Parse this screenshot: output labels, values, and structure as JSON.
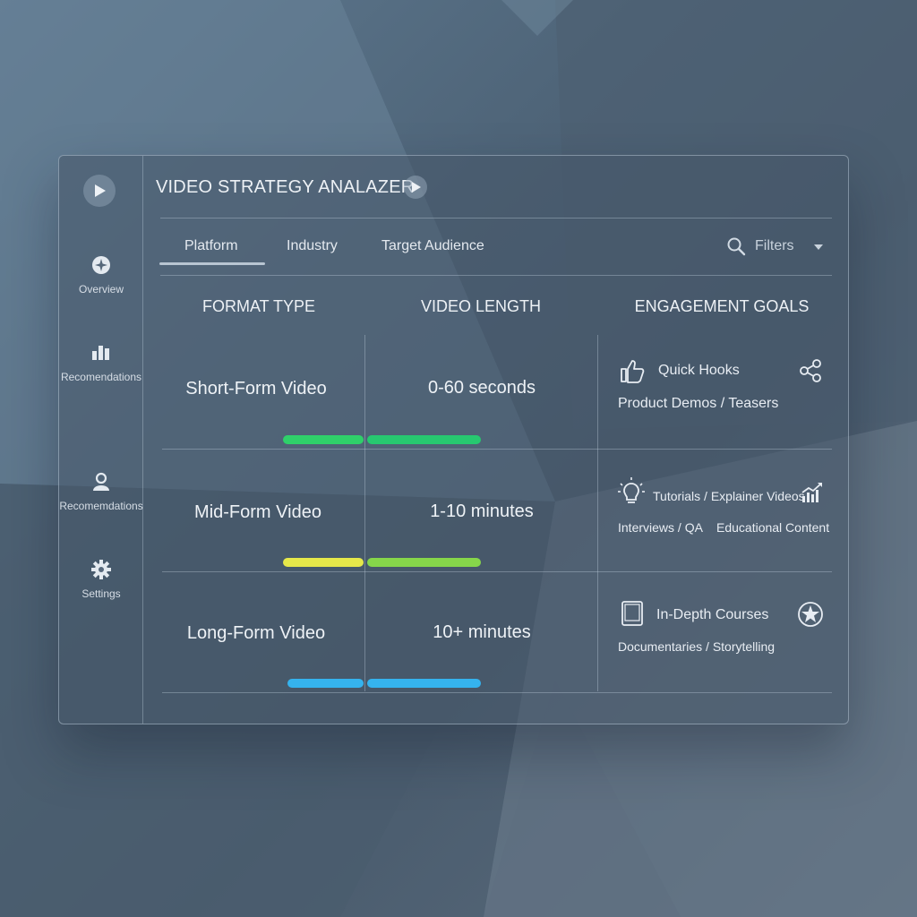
{
  "app": {
    "title": "VIDEO STRATEGY ANALAZER",
    "play_icon": "play-icon"
  },
  "sidebar": {
    "items": [
      {
        "label": "Overview",
        "icon": "compass-icon"
      },
      {
        "label": "Recomendations",
        "icon": "chart-icon"
      },
      {
        "label": "Recomemdations",
        "icon": "user-icon"
      },
      {
        "label": "Settings",
        "icon": "gear-icon"
      }
    ]
  },
  "tabs": [
    {
      "label": "Platform",
      "active": true
    },
    {
      "label": "Industry",
      "active": false
    },
    {
      "label": "Target Audience",
      "active": false
    }
  ],
  "filters": {
    "label": "Filters",
    "icon": "search-icon"
  },
  "columns": [
    "FORMAT TYPE",
    "VIDEO LENGTH",
    "ENGAGEMENT GOALS"
  ],
  "rows": [
    {
      "format": "Short-Form Video",
      "length": "0-60 seconds",
      "bar_colors": [
        "#2fd06a",
        "#27c870"
      ],
      "goals": [
        "Quick Hooks",
        "Product Demos / Teasers"
      ],
      "icons": [
        "thumbs-up-icon",
        "share-icon"
      ]
    },
    {
      "format": "Mid-Form Video",
      "length": "1-10 minutes",
      "bar_colors": [
        "#e6e84a",
        "#86d64a"
      ],
      "goals": [
        "Tutorials / Explainer Videos",
        "Interviews / QA",
        "Educational Content"
      ],
      "icons": [
        "lightbulb-icon",
        "growth-chart-icon"
      ]
    },
    {
      "format": "Long-Form Video",
      "length": "10+ minutes",
      "bar_colors": [
        "#35b3ee",
        "#35b3ee"
      ],
      "goals": [
        "In-Depth Courses",
        "Documentaries / Storytelling"
      ],
      "icons": [
        "tablet-icon",
        "globe-icon"
      ]
    }
  ],
  "colors": {
    "accent": "#b8c5d2",
    "panel_border": "#c8d6e4"
  }
}
